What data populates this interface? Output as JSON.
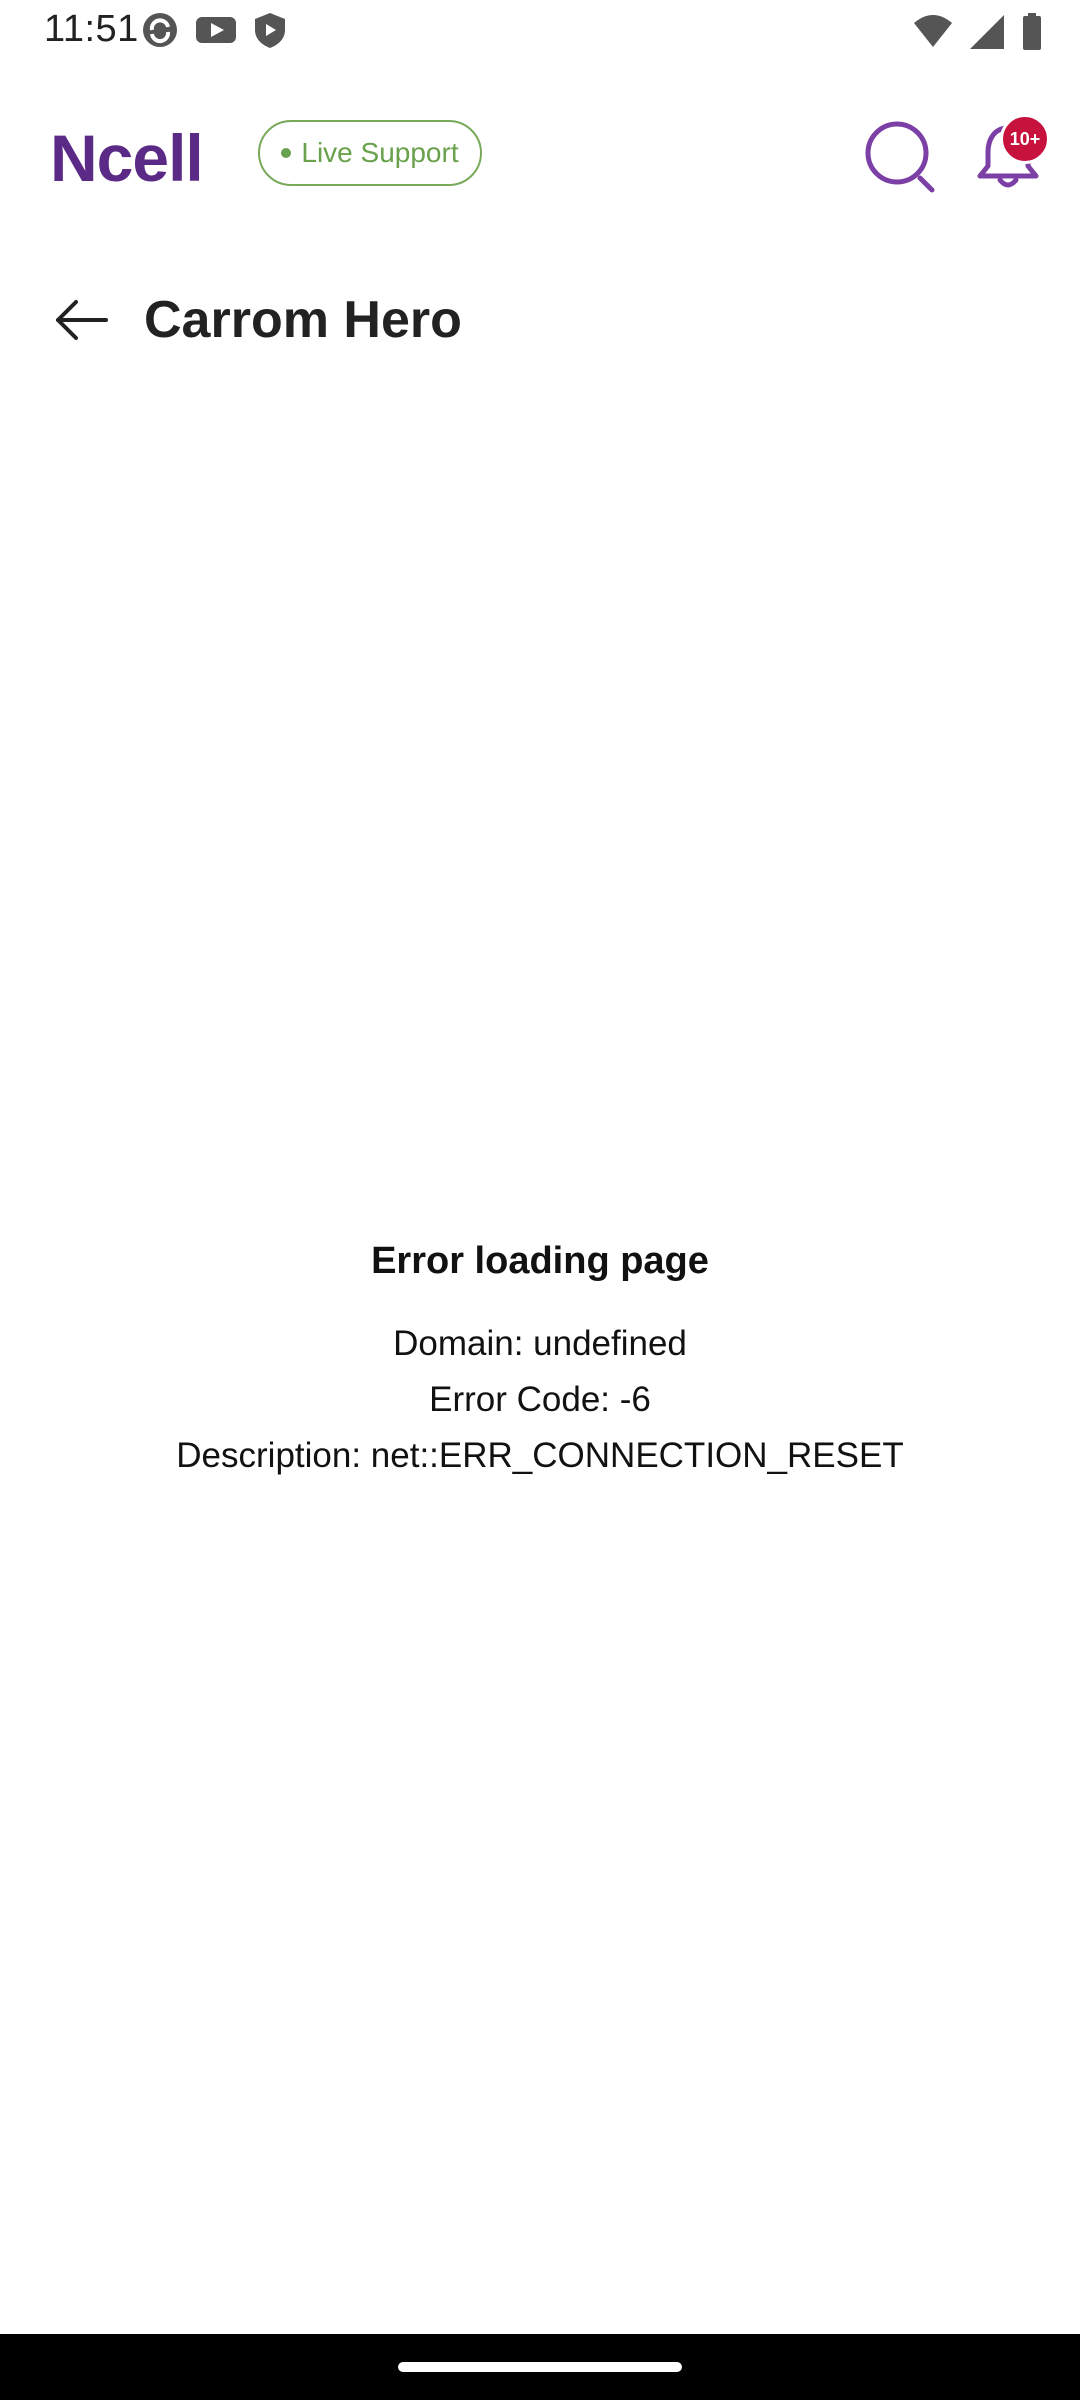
{
  "status_bar": {
    "time": "11:51",
    "left_icons": [
      "sync-icon",
      "youtube-icon",
      "shield-icon"
    ],
    "right_icons": [
      "wifi-icon",
      "signal-icon",
      "battery-icon"
    ]
  },
  "header": {
    "logo_text": "Ncell",
    "live_support_label": "Live Support",
    "notification_badge": "10+",
    "colors": {
      "brand": "#5b2a86",
      "live_support": "#6aa14c",
      "badge": "#c8123e"
    }
  },
  "page": {
    "title": "Carrom Hero"
  },
  "error": {
    "title": "Error loading page",
    "domain_line": "Domain: undefined",
    "code_line": "Error Code: -6",
    "description_line": "Description: net::ERR_CONNECTION_RESET"
  }
}
